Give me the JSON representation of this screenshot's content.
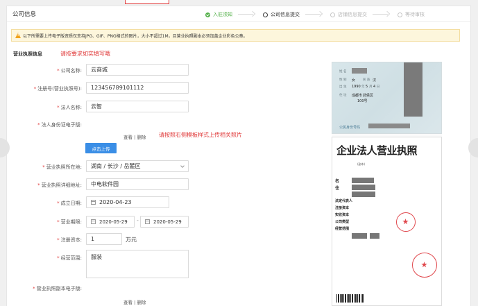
{
  "card": {
    "title": "公司信息"
  },
  "steps": [
    {
      "label": "入驻须知",
      "state": "done"
    },
    {
      "label": "公司信息提交",
      "state": "active"
    },
    {
      "label": "店铺信息提交",
      "state": "todo"
    },
    {
      "label": "等待审核",
      "state": "todo"
    }
  ],
  "notice": {
    "text": "以下所需要上传电子版资质仅支持JPG、GIF、PNG格式的图片，大小不超过1M，且营业执照副本必须加盖企业彩色公章。"
  },
  "section": {
    "title": "营业执照信息"
  },
  "hints": {
    "fill_truthfully": "请按要求如实填写哦",
    "upload_sample": "请按照右侧模板样式上传相关照片"
  },
  "form": {
    "company_name": {
      "label": "公司名称:",
      "value": "云商城"
    },
    "reg_no": {
      "label": "注册号(营业执照号):",
      "value": "123456789101112"
    },
    "legal_person": {
      "label": "法人名称:",
      "value": "云智"
    },
    "legal_id_photo": {
      "label": "法人身份证电子版:",
      "view": "查看",
      "delete": "删除",
      "upload": "点击上传"
    },
    "location": {
      "label": "营业执照所在地:",
      "value": "湖南 / 长沙 / 岳麓区"
    },
    "address": {
      "label": "营业执照详细地址:",
      "value": "中电软件园"
    },
    "founded": {
      "label": "成立日期:",
      "value": "2020-04-23"
    },
    "business_term": {
      "label": "营业期限:",
      "from": "2020-05-29",
      "sep": "-",
      "to": "2020-05-29"
    },
    "capital": {
      "label": "注册资本:",
      "value": "1",
      "unit": "万元"
    },
    "scope": {
      "label": "经营范围:",
      "value": "服装"
    },
    "license_copy": {
      "label": "营业执照副本电子版:",
      "view": "查看",
      "delete": "删除"
    }
  },
  "sample": {
    "idcard": {
      "fields": [
        "姓",
        "名",
        "性",
        "别",
        "民",
        "族",
        "出",
        "生",
        "住",
        "址"
      ],
      "values": [
        "女",
        "汉",
        "1990",
        "年",
        "5",
        "月",
        "4",
        "日",
        "成都市",
        "武侯区",
        "100号"
      ],
      "id_label": "公民身份号码"
    },
    "license": {
      "title": "企业法人营业执照",
      "left_labels": [
        "名",
        "住",
        "法定代表人",
        "注册资本",
        "实收资本",
        "公司类型",
        "经营范围"
      ]
    }
  },
  "colors": {
    "accent": "#3a8ee6",
    "success": "#54b04a",
    "danger": "#e03a3a",
    "warn": "#f0a21a"
  }
}
